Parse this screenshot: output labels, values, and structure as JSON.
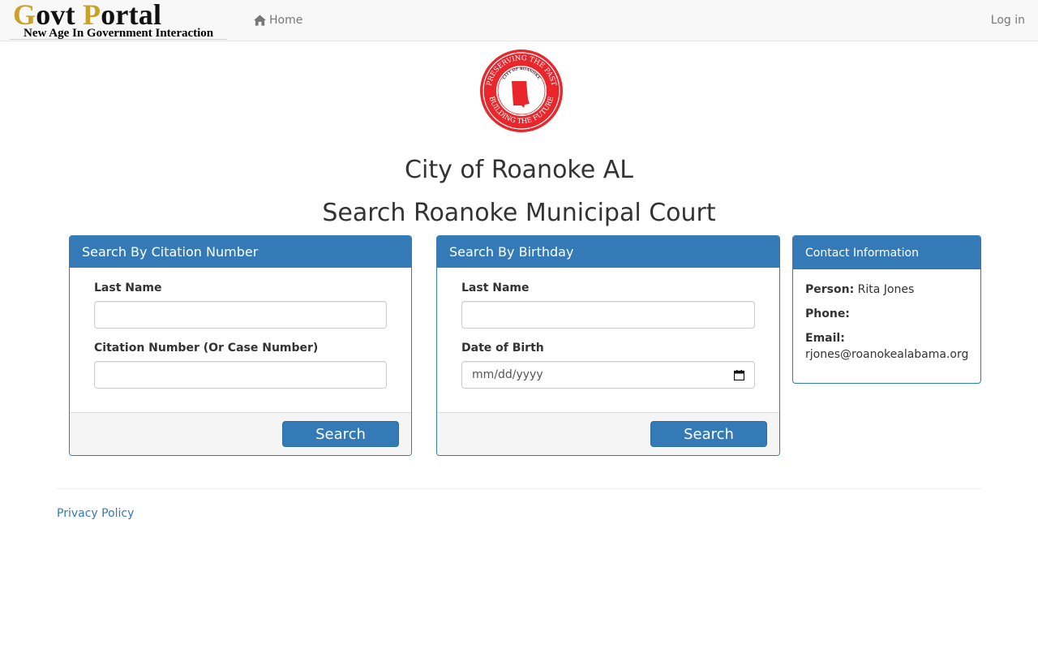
{
  "navbar": {
    "brand_g": "G",
    "brand_ovt": "ovt ",
    "brand_p": "P",
    "brand_ortal": "ortal",
    "brand_tagline": "New Age In Government Interaction",
    "home_label": "Home",
    "home_icon": "home-icon",
    "login_label": "Log in"
  },
  "seal": {
    "ring_text_top": "PRESERVING THE PAST",
    "ring_text_bottom": "BUILDING THE FUTURE",
    "inner_text": "CITY OF ROANOKE",
    "color": "#e8262b"
  },
  "header": {
    "city_title": "City of Roanoke AL",
    "court_title": "Search Roanoke Municipal Court"
  },
  "citation_panel": {
    "title": "Search By Citation Number",
    "last_name_label": "Last Name",
    "last_name_value": "",
    "citation_label": "Citation Number (Or Case Number)",
    "citation_value": "",
    "search_label": "Search"
  },
  "birthday_panel": {
    "title": "Search By Birthday",
    "last_name_label": "Last Name",
    "last_name_value": "",
    "dob_label": "Date of Birth",
    "dob_placeholder": "mm/dd/yyyy",
    "search_label": "Search"
  },
  "contact_panel": {
    "title": "Contact Information",
    "person_label": "Person:",
    "person_value": "Rita Jones",
    "phone_label": "Phone:",
    "phone_value": "",
    "email_label": "Email:",
    "email_value": "rjones@roanokealabama.org"
  },
  "footer": {
    "privacy_label": "Privacy Policy"
  },
  "colors": {
    "primary": "#337ab7",
    "brand_gold": "#c9a227",
    "navbar_bg": "#f8f8f8"
  }
}
